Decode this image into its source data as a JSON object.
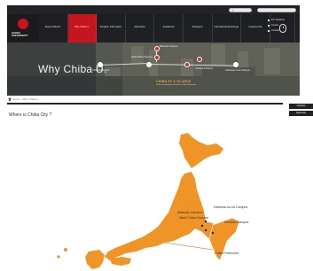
{
  "header": {
    "logo_line1": "CHIBA",
    "logo_line2": "UNIVERSITY",
    "search_placeholder": "",
    "nav": [
      {
        "label": "About Chiba U.",
        "active": false
      },
      {
        "label": "Why Chiba U.",
        "active": true
      },
      {
        "label": "Program Information",
        "active": false
      },
      {
        "label": "Admission",
        "active": false
      },
      {
        "label": "Academics",
        "active": false
      },
      {
        "label": "Research",
        "active": false
      },
      {
        "label": "International Exchange",
        "active": false
      },
      {
        "label": "Campus Life",
        "active": false
      }
    ],
    "languages": [
      "For Students",
      "Access",
      "Contact"
    ],
    "hero_heading": "Why Chiba U.",
    "hero_markers": [
      "Matsudo Campus",
      "Nishi-Chiba Campus",
      "Inohana Campus",
      "Kashiwa-no-ha Campus",
      "Chiba Prefecture"
    ],
    "feature_title": "CHIBA AT A GLANCE",
    "feature_sub": "Chiba University is located in Chiba Prefecture"
  },
  "breadcrumb": {
    "home": "Home",
    "current": "Why Chiba U."
  },
  "main": {
    "title": "Where is Chiba City ?",
    "map_labels": {
      "matsudo": "Matsudo Campus",
      "kashiwa": "Kashiwa-no-ha Campus",
      "nishichiba": "Nishi-Chiba Campus",
      "inohana": "Inohana Campus",
      "prefecture": "Chiba Prefecture"
    }
  },
  "sidebar": {
    "buttons": [
      "Inquiries",
      "Japanese"
    ]
  },
  "colors": {
    "accent": "#c6151f",
    "map_orange": "#f39a2c",
    "map_stripe": "#e5851a"
  }
}
